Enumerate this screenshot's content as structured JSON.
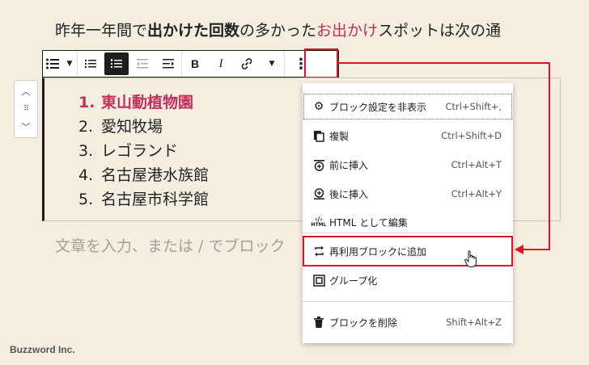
{
  "paragraph": {
    "part1": "昨年一年間で",
    "bold": "出かけた回数",
    "part2": "の多かった",
    "link": "お出かけ",
    "part3": "スポットは次の通"
  },
  "toolbar": {
    "bold": "B",
    "italic": "I",
    "more_label": "⋮"
  },
  "list": {
    "items": [
      {
        "num": "1.",
        "text": "東山動植物園"
      },
      {
        "num": "2.",
        "text": "愛知牧場"
      },
      {
        "num": "3.",
        "text": "レゴランド"
      },
      {
        "num": "4.",
        "text": "名古屋港水族館"
      },
      {
        "num": "5.",
        "text": "名古屋市科学館"
      }
    ]
  },
  "placeholder": "文章を入力、または / でブロック",
  "menu": {
    "items": [
      {
        "label": "ブロック設定を非表示",
        "shortcut": "Ctrl+Shift+,"
      },
      {
        "label": "複製",
        "shortcut": "Ctrl+Shift+D"
      },
      {
        "label": "前に挿入",
        "shortcut": "Ctrl+Alt+T"
      },
      {
        "label": "後に挿入",
        "shortcut": "Ctrl+Alt+Y"
      },
      {
        "label": "HTML として編集",
        "shortcut": ""
      },
      {
        "label": "再利用ブロックに追加",
        "shortcut": ""
      },
      {
        "label": "グループ化",
        "shortcut": ""
      },
      {
        "label": "ブロックを削除",
        "shortcut": "Shift+Alt+Z"
      }
    ],
    "html_icon_text": "HTML"
  },
  "colors": {
    "highlight": "#e0141e",
    "link": "#c42e5b"
  },
  "footer": "Buzzword Inc."
}
